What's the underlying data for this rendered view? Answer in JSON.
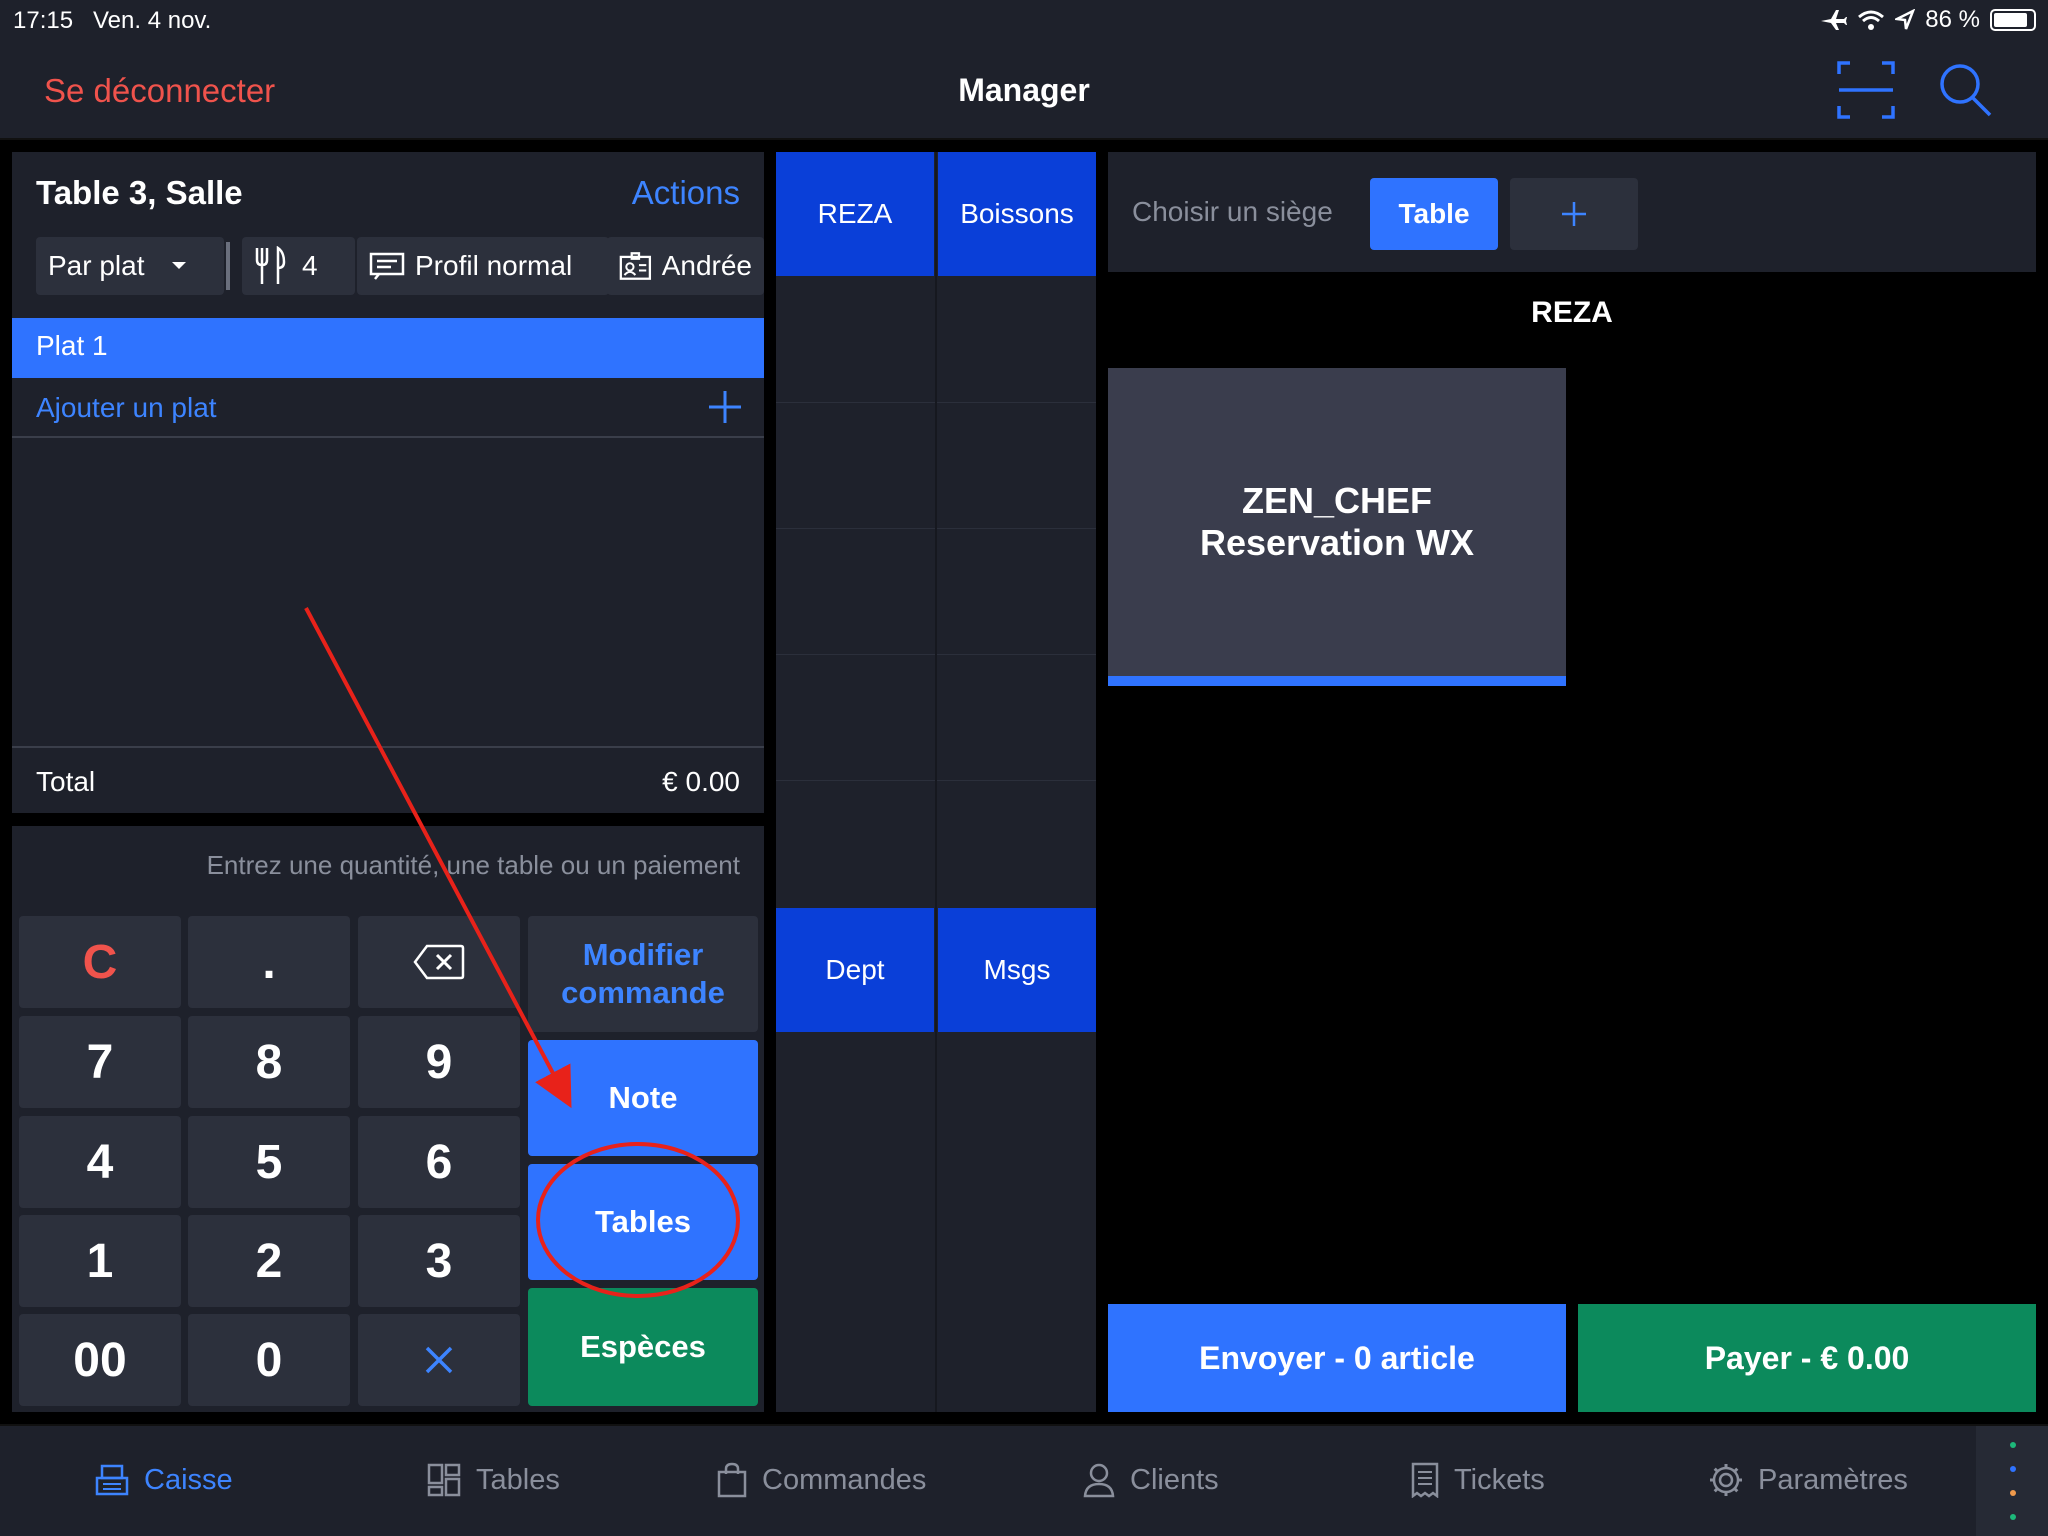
{
  "status_bar": {
    "time": "17:15",
    "date": "Ven. 4 nov.",
    "battery": "86 %"
  },
  "nav": {
    "logout": "Se déconnecter",
    "title": "Manager"
  },
  "order": {
    "title": "Table 3, Salle",
    "actions": "Actions",
    "mode": "Par plat",
    "guests": "4",
    "profile": "Profil normal",
    "staff": "Andrée",
    "course": "Plat 1",
    "add_course": "Ajouter un plat",
    "total_label": "Total",
    "total_value": "€ 0.00"
  },
  "keypad": {
    "hint": "Entrez une quantité, une table ou un paiement",
    "clear": "C",
    "dot": ".",
    "keys": [
      "7",
      "8",
      "9",
      "4",
      "5",
      "6",
      "1",
      "2",
      "3",
      "00",
      "0"
    ],
    "modify_line1": "Modifier",
    "modify_line2": "commande",
    "note": "Note",
    "tables": "Tables",
    "cash": "Espèces"
  },
  "categories": {
    "top": [
      "REZA",
      "Boissons"
    ],
    "bottom": [
      "Dept",
      "Msgs"
    ]
  },
  "seat_bar": {
    "label": "Choisir un siège",
    "table": "Table"
  },
  "menu": {
    "title": "REZA",
    "item_line1": "ZEN_CHEF",
    "item_line2": "Reservation WX"
  },
  "footer_buttons": {
    "send": "Envoyer - 0 article",
    "pay": "Payer - € 0.00"
  },
  "tabs": [
    "Caisse",
    "Tables",
    "Commandes",
    "Clients",
    "Tickets",
    "Paramètres"
  ],
  "colors": {
    "accent": "#2f73ff",
    "pay_green": "#0c8a5c",
    "logout_red": "#f0534c",
    "annotation_red": "#e8221a"
  }
}
